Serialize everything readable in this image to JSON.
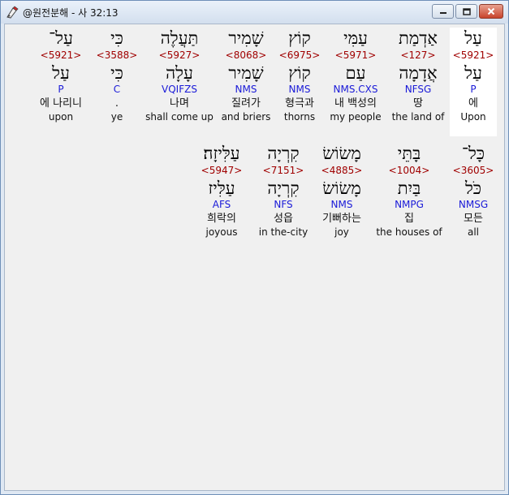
{
  "window": {
    "title": "@원전분해 - 사 32:13"
  },
  "controls": {
    "minimize": "minimize",
    "maximize": "maximize",
    "close": "close"
  },
  "rows": [
    {
      "words": [
        {
          "heb": "עַל",
          "strong": "<5921>",
          "lex": "עַל",
          "parse": "P",
          "ko": "에",
          "en": "Upon"
        },
        {
          "heb": "אַדְמַת",
          "strong": "<127>",
          "lex": "אֲדָמָה",
          "parse": "NFSG",
          "ko": "땅",
          "en": "the land of"
        },
        {
          "heb": "עַמִּי",
          "strong": "<5971>",
          "lex": "עַם",
          "parse": "NMS.CXS",
          "ko": "내 백성의",
          "en": "my people"
        },
        {
          "heb": "קוֹץ",
          "strong": "<6975>",
          "lex": "קוֹץ",
          "parse": "NMS",
          "ko": "형극과",
          "en": "thorns"
        },
        {
          "heb": "שָׁמִיר",
          "strong": "<8068>",
          "lex": "שָׁמִיר",
          "parse": "NMS",
          "ko": "질려가",
          "en": "and briers"
        },
        {
          "heb": "תַּעֲלֶה",
          "strong": "<5927>",
          "lex": "עָלָה",
          "parse": "VQIFZS",
          "ko": "나며",
          "en": "shall come up"
        },
        {
          "heb": "כִּי",
          "strong": "<3588>",
          "lex": "כִּי",
          "parse": "C",
          "ko": ".",
          "en": "ye"
        },
        {
          "heb": "עַל־",
          "strong": "<5921>",
          "lex": "עַל",
          "parse": "P",
          "ko": "에 나리니",
          "en": "upon"
        }
      ]
    },
    {
      "words": [
        {
          "heb": "כָּל־",
          "strong": "<3605>",
          "lex": "כֹּל",
          "parse": "NMSG",
          "ko": "모든",
          "en": "all"
        },
        {
          "heb": "בָּתֵּי",
          "strong": "<1004>",
          "lex": "בַּיִת",
          "parse": "NMPG",
          "ko": "집",
          "en": "the houses of"
        },
        {
          "heb": "מָשׂוֹשׂ",
          "strong": "<4885>",
          "lex": "מָשׂוֹשׂ",
          "parse": "NMS",
          "ko": "기뻐하는",
          "en": "joy"
        },
        {
          "heb": "קִרְיָה",
          "strong": "<7151>",
          "lex": "קִרְיָה",
          "parse": "NFS",
          "ko": "성읍",
          "en": "in the-city"
        },
        {
          "heb": "עַלִּיזָה׃",
          "strong": "<5947>",
          "lex": "עַלִּיז",
          "parse": "AFS",
          "ko": "희락의",
          "en": "joyous"
        }
      ]
    }
  ]
}
